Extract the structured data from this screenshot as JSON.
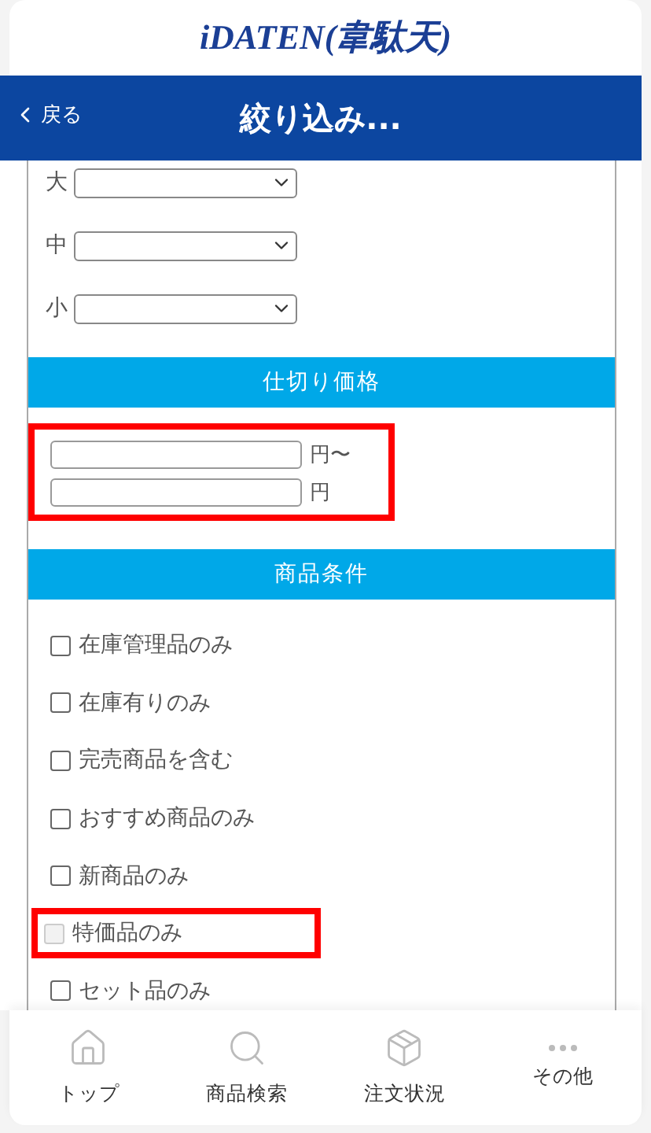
{
  "logo": "iDATEN(韋駄天)",
  "header": {
    "back": "戻る",
    "title": "絞り込み..."
  },
  "categories": [
    {
      "label": "大"
    },
    {
      "label": "中"
    },
    {
      "label": "小"
    }
  ],
  "price": {
    "heading": "仕切り価格",
    "highlighted": true,
    "fields": [
      {
        "unit": "円〜"
      },
      {
        "unit": "円"
      }
    ]
  },
  "conditions": {
    "heading": "商品条件",
    "items": [
      {
        "label": "在庫管理品のみ",
        "checked": false,
        "disabled": false,
        "highlighted": false
      },
      {
        "label": "在庫有りのみ",
        "checked": false,
        "disabled": false,
        "highlighted": false
      },
      {
        "label": "完売商品を含む",
        "checked": false,
        "disabled": false,
        "highlighted": false
      },
      {
        "label": "おすすめ商品のみ",
        "checked": false,
        "disabled": false,
        "highlighted": false
      },
      {
        "label": "新商品のみ",
        "checked": false,
        "disabled": false,
        "highlighted": false
      },
      {
        "label": "特価品のみ",
        "checked": false,
        "disabled": true,
        "highlighted": true
      },
      {
        "label": "セット品のみ",
        "checked": false,
        "disabled": false,
        "highlighted": false
      }
    ]
  },
  "tabbar": [
    {
      "kind": "home",
      "label": "トップ"
    },
    {
      "kind": "search",
      "label": "商品検索"
    },
    {
      "kind": "box",
      "label": "注文状況"
    },
    {
      "kind": "more",
      "label": "その他"
    }
  ]
}
